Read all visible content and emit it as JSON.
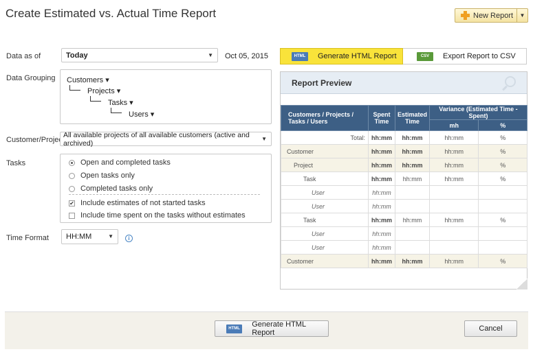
{
  "title": "Create Estimated vs. Actual Time Report",
  "new_report": "New Report",
  "data_as_of": {
    "label": "Data as of",
    "value": "Today",
    "date": "Oct 05, 2015"
  },
  "grouping": {
    "label": "Data Grouping",
    "levels": [
      "Customers",
      "Projects",
      "Tasks",
      "Users"
    ]
  },
  "customer_project": {
    "label": "Customer/Project",
    "value": "All available projects of all available customers (active and archived)"
  },
  "tasks": {
    "label": "Tasks",
    "options": [
      {
        "label": "Open and completed tasks",
        "selected": true
      },
      {
        "label": "Open tasks only",
        "selected": false
      },
      {
        "label": "Completed tasks only",
        "selected": false
      }
    ],
    "checks": [
      {
        "label": "Include estimates of not started tasks",
        "checked": true
      },
      {
        "label": "Include time spent on the tasks without estimates",
        "checked": false
      }
    ]
  },
  "time_format": {
    "label": "Time Format",
    "value": "HH:MM",
    "info_icon": "info-icon"
  },
  "tabs": {
    "generate": "Generate HTML Report",
    "export": "Export Report to CSV",
    "html_badge": "HTML",
    "csv_badge": "CSV"
  },
  "preview": {
    "title": "Report Preview",
    "headers": {
      "col1": "Customers / Projects / Tasks / Users",
      "spent": "Spent Time",
      "estimated": "Estimated Time",
      "variance": "Variance (Estimated Time - Spent)",
      "hm": "mh",
      "pct": "%"
    },
    "rows": [
      {
        "name": "Total:",
        "spent": "hh:mm",
        "est": "hh:mm",
        "var": "hh:mm",
        "pct": "%",
        "kind": "total"
      },
      {
        "name": "Customer",
        "spent": "hh:mm",
        "est": "hh:mm",
        "var": "hh:mm",
        "pct": "%",
        "kind": "cust"
      },
      {
        "name": "Project",
        "spent": "hh:mm",
        "est": "hh:mm",
        "var": "hh:mm",
        "pct": "%",
        "kind": "cust"
      },
      {
        "name": "Task",
        "spent": "hh:mm",
        "est": "hh:mm",
        "var": "hh:mm",
        "pct": "%",
        "kind": "task"
      },
      {
        "name": "User",
        "spent": "hh:mm",
        "est": "",
        "var": "",
        "pct": "",
        "kind": "user"
      },
      {
        "name": "User",
        "spent": "hh:mm",
        "est": "",
        "var": "",
        "pct": "",
        "kind": "user"
      },
      {
        "name": "Task",
        "spent": "hh:mm",
        "est": "hh:mm",
        "var": "hh:mm",
        "pct": "%",
        "kind": "task"
      },
      {
        "name": "User",
        "spent": "hh:mm",
        "est": "",
        "var": "",
        "pct": "",
        "kind": "user"
      },
      {
        "name": "User",
        "spent": "hh:mm",
        "est": "",
        "var": "",
        "pct": "",
        "kind": "user"
      },
      {
        "name": "Customer",
        "spent": "hh:mm",
        "est": "hh:mm",
        "var": "hh:mm",
        "pct": "%",
        "kind": "cust"
      }
    ]
  },
  "footer": {
    "generate": "Generate HTML Report",
    "cancel": "Cancel",
    "html_badge": "HTML"
  }
}
